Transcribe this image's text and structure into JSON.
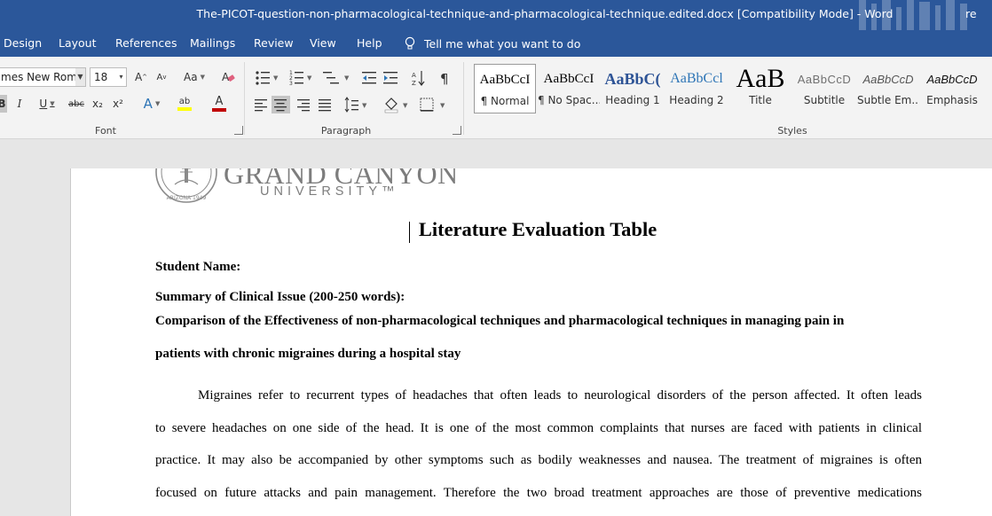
{
  "window": {
    "title": "The-PICOT-question-non-pharmacological-technique-and-pharmacological-technique.edited.docx [Compatibility Mode]  -  Word",
    "user_partial": "re"
  },
  "tabs": [
    "Design",
    "Layout",
    "References",
    "Mailings",
    "Review",
    "View",
    "Help"
  ],
  "tell_me": "Tell me what you want to do",
  "ribbon": {
    "font": {
      "name_value": "mes New Roma",
      "size_value": "18",
      "group_label": "Font",
      "buttons": {
        "grow": "A",
        "shrink": "A",
        "change_case": "Aa",
        "bold": "B",
        "italic": "I",
        "underline": "U",
        "strike": "abc",
        "subscript": "x₂",
        "superscript": "x²",
        "text_effects": "A",
        "highlight": "ab",
        "font_color": "A"
      }
    },
    "paragraph": {
      "group_label": "Paragraph",
      "show_marks": "¶"
    },
    "styles": {
      "group_label": "Styles",
      "items": [
        {
          "preview": "AaBbCcI",
          "name": "¶ Normal"
        },
        {
          "preview": "AaBbCcI",
          "name": "¶ No Spac..."
        },
        {
          "preview": "AaBbC(",
          "name": "Heading 1"
        },
        {
          "preview": "AaBbCcl",
          "name": "Heading 2"
        },
        {
          "preview": "AaB",
          "name": "Title"
        },
        {
          "preview": "AaBbCcD",
          "name": "Subtitle"
        },
        {
          "preview": "AaBbCcD",
          "name": "Subtle Em..."
        },
        {
          "preview": "AaBbCcD",
          "name": "Emphasis"
        }
      ]
    }
  },
  "document": {
    "logo": {
      "line1": "GRAND CANYON",
      "line2": "UNIVERSITY™",
      "seal_text": "ARIZONA 1949"
    },
    "heading": "Literature Evaluation Table",
    "student_label": "Student Name:",
    "summary_label": "Summary of Clinical Issue (200-250 words):",
    "topic_lines": [
      "Comparison of the Effectiveness of non-pharmacological techniques and pharmacological techniques in managing pain in",
      "patients with chronic migraines during a hospital stay"
    ],
    "body_lines": [
      "Migraines refer to recurrent types of headaches that often leads to neurological disorders of the person affected. It often leads",
      "to severe headaches on one side of the head. It is one of the most common complaints that nurses are faced with patients in clinical",
      "practice. It may also be accompanied by other symptoms such as bodily weaknesses and nausea. The treatment of migraines is often",
      "focused on future attacks and pain management. Therefore the two broad treatment approaches are those of preventive medications"
    ]
  },
  "colors": {
    "accent": "#2b579a",
    "font_color_bar": "#c00000",
    "highlight_bar": "#ffff00"
  }
}
